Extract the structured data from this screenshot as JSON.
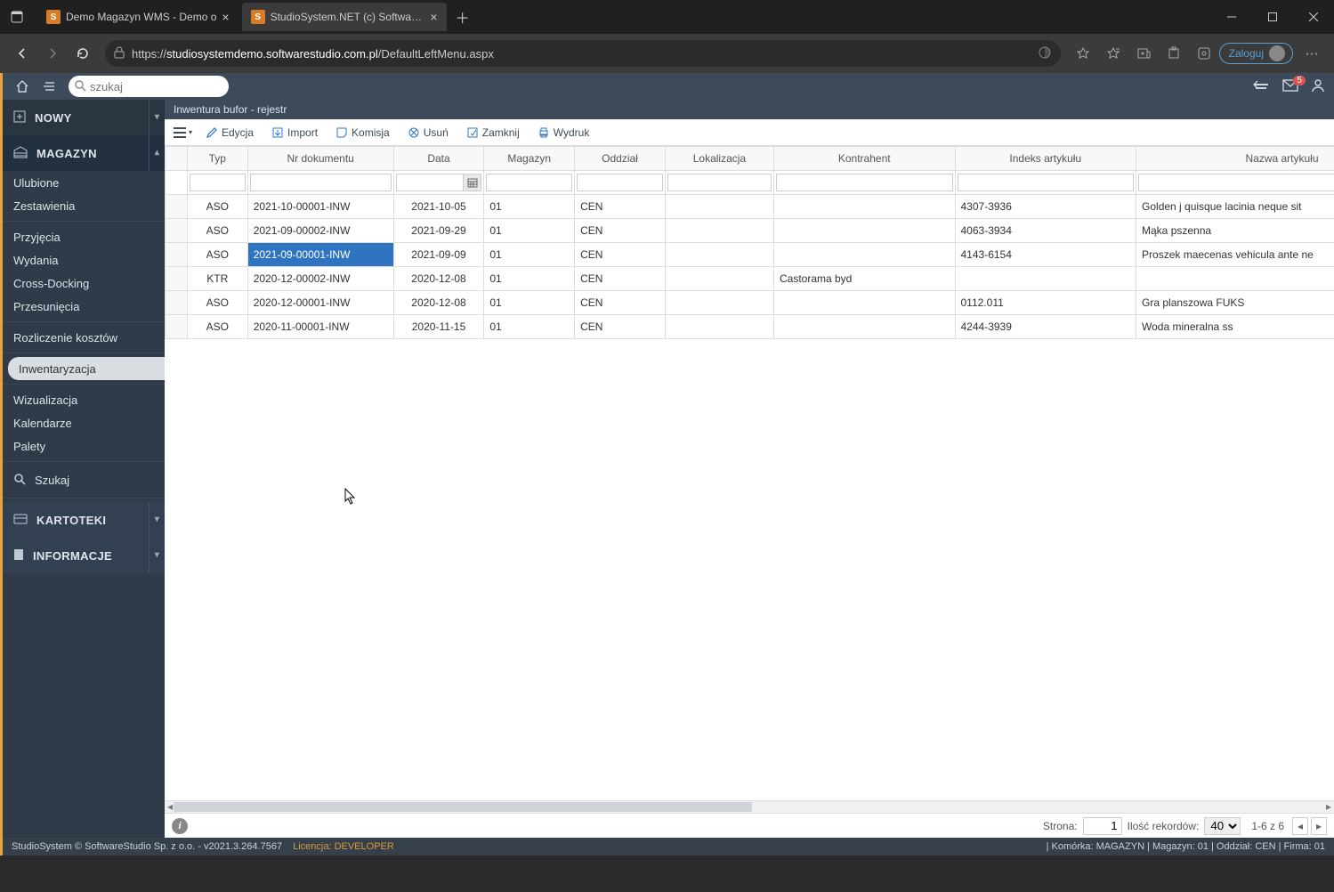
{
  "browser": {
    "tabs": [
      {
        "title": "Demo Magazyn WMS - Demo o",
        "active": false,
        "favicon": "S"
      },
      {
        "title": "StudioSystem.NET (c) SoftwareSt",
        "active": true,
        "favicon": "S"
      }
    ],
    "url_prefix": "https://",
    "url_domain": "studiosystemdemo.softwarestudio.com.pl",
    "url_path": "/DefaultLeftMenu.aspx",
    "login_label": "Zaloguj"
  },
  "app": {
    "search_placeholder": "szukaj",
    "mail_badge": "5"
  },
  "sidebar": {
    "nowy": "NOWY",
    "magazyn": "MAGAZYN",
    "kartoteki": "KARTOTEKI",
    "informacje": "INFORMACJE",
    "items_a": [
      "Ulubione",
      "Zestawienia"
    ],
    "items_b": [
      "Przyjęcia",
      "Wydania",
      "Cross-Docking",
      "Przesunięcia"
    ],
    "items_c": [
      "Rozliczenie kosztów"
    ],
    "items_d": [
      "Inwentaryzacja"
    ],
    "items_e": [
      "Wizualizacja",
      "Kalendarze",
      "Palety"
    ],
    "szukaj": "Szukaj"
  },
  "register": {
    "title": "Inwentura bufor - rejestr",
    "toolbar": {
      "edycja": "Edycja",
      "import": "Import",
      "komisja": "Komisja",
      "usun": "Usuń",
      "zamknij": "Zamknij",
      "wydruk": "Wydruk"
    },
    "columns": [
      "Typ",
      "Nr dokumentu",
      "Data",
      "Magazyn",
      "Oddział",
      "Lokalizacja",
      "Kontrahent",
      "Indeks artykułu",
      "Nazwa artykułu"
    ],
    "rows": [
      {
        "typ": "ASO",
        "nr": "2021-10-00001-INW",
        "data": "2021-10-05",
        "mag": "01",
        "odd": "CEN",
        "lok": "",
        "kon": "",
        "idx": "4307-3936",
        "naz": "Golden j quisque lacinia neque sit"
      },
      {
        "typ": "ASO",
        "nr": "2021-09-00002-INW",
        "data": "2021-09-29",
        "mag": "01",
        "odd": "CEN",
        "lok": "",
        "kon": "",
        "idx": "4063-3934",
        "naz": "Mąka pszenna"
      },
      {
        "typ": "ASO",
        "nr": "2021-09-00001-INW",
        "data": "2021-09-09",
        "mag": "01",
        "odd": "CEN",
        "lok": "",
        "kon": "",
        "idx": "4143-6154",
        "naz": "Proszek maecenas vehicula ante ne"
      },
      {
        "typ": "KTR",
        "nr": "2020-12-00002-INW",
        "data": "2020-12-08",
        "mag": "01",
        "odd": "CEN",
        "lok": "",
        "kon": "Castorama byd",
        "idx": "",
        "naz": ""
      },
      {
        "typ": "ASO",
        "nr": "2020-12-00001-INW",
        "data": "2020-12-08",
        "mag": "01",
        "odd": "CEN",
        "lok": "",
        "kon": "",
        "idx": "0112.011",
        "naz": "Gra planszowa FUKS"
      },
      {
        "typ": "ASO",
        "nr": "2020-11-00001-INW",
        "data": "2020-11-15",
        "mag": "01",
        "odd": "CEN",
        "lok": "",
        "kon": "",
        "idx": "4244-3939",
        "naz": "Woda mineralna ss"
      }
    ],
    "selected_row": 2,
    "selected_col": "nr"
  },
  "footer": {
    "strona_label": "Strona:",
    "page": "1",
    "ilosc_label": "Ilość rekordów:",
    "page_size": "40",
    "range": "1-6 z 6"
  },
  "status": {
    "left": "StudioSystem © SoftwareStudio Sp. z o.o. - v2021.3.264.7567",
    "lic_label": "Licencja: ",
    "lic_value": "DEVELOPER",
    "right": "| Komórka: MAGAZYN | Magazyn: 01 | Oddział: CEN | Firma: 01"
  }
}
